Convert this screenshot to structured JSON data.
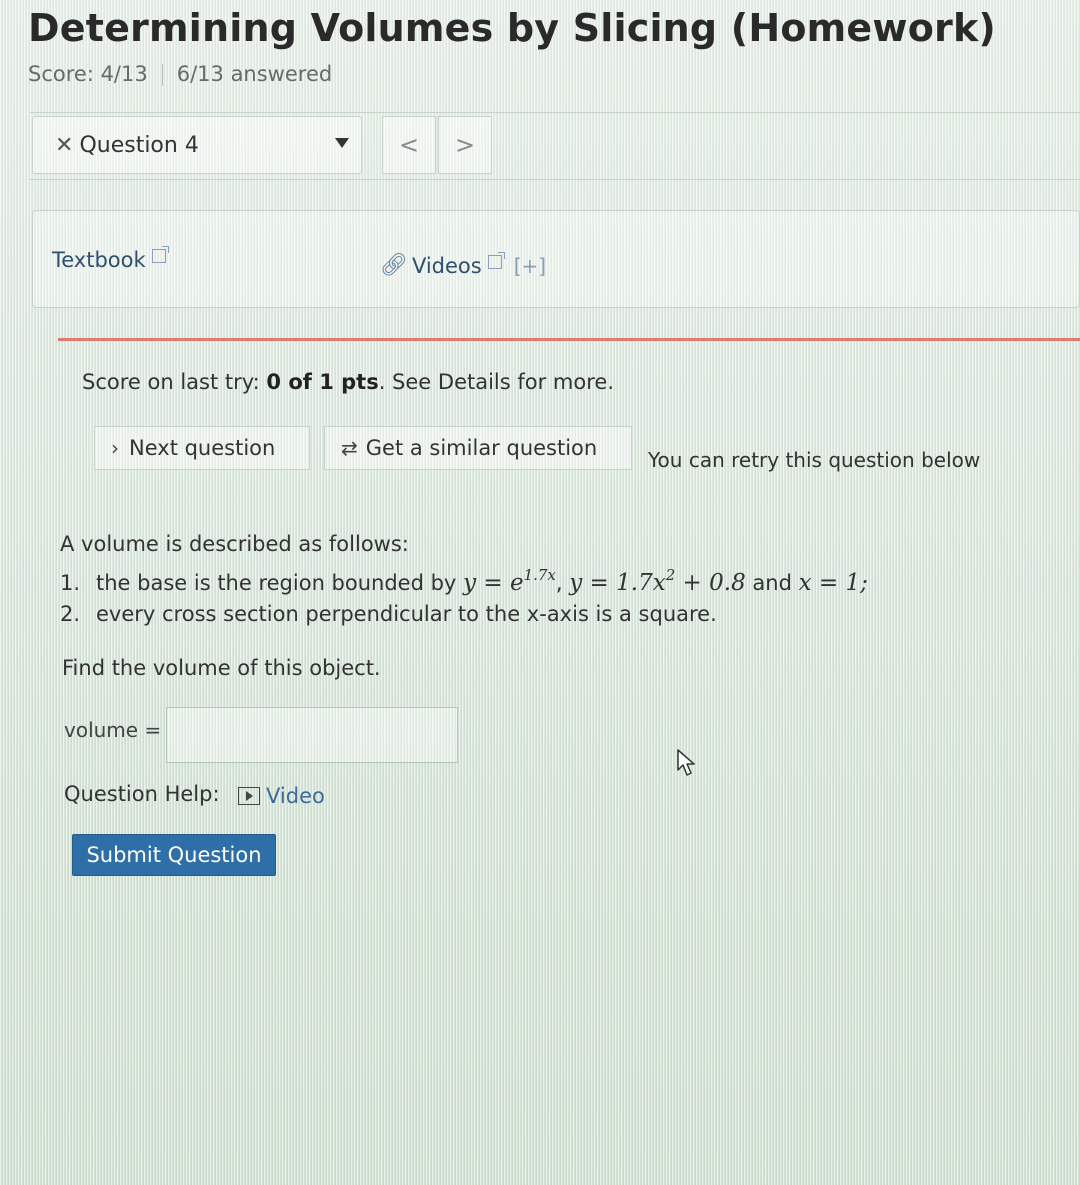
{
  "header": {
    "title": "Determining Volumes by Slicing (Homework)",
    "score": "Score: 4/13",
    "answered": "6/13 answered"
  },
  "question_nav": {
    "current": "Question 4",
    "prev_label": "<",
    "next_label": ">"
  },
  "resources": {
    "textbook": "Textbook",
    "videos": "Videos",
    "expand": "[+]"
  },
  "feedback": {
    "prefix": "Score on last try: ",
    "score": "0 of 1 pts",
    "suffix": ". See Details for more."
  },
  "actions": {
    "next_question": "Next question",
    "similar_question": "Get a similar question",
    "retry_note": "You can retry this question below"
  },
  "question": {
    "intro": "A volume is described as follows:",
    "condition1": {
      "number": "1.",
      "text": "the base is the region bounded by",
      "eq1_lhs": "y = e",
      "eq1_exp": "1.7x",
      "eq2_lhs": "y = 1.7x",
      "eq2_exp": "2",
      "eq2_rest": " + 0.8",
      "joiner": "and",
      "eq3": "x = 1;"
    },
    "condition2": {
      "number": "2.",
      "text": "every cross section perpendicular to the x-axis is a square."
    },
    "prompt": "Find the volume of this object.",
    "answer_label": "volume =",
    "answer_value": ""
  },
  "help": {
    "label": "Question Help:",
    "video": "Video"
  },
  "submit": {
    "label": "Submit Question"
  },
  "colors": {
    "submit_bg": "#2f6fa8",
    "divider": "#e07b72",
    "link": "#3d6a96"
  }
}
